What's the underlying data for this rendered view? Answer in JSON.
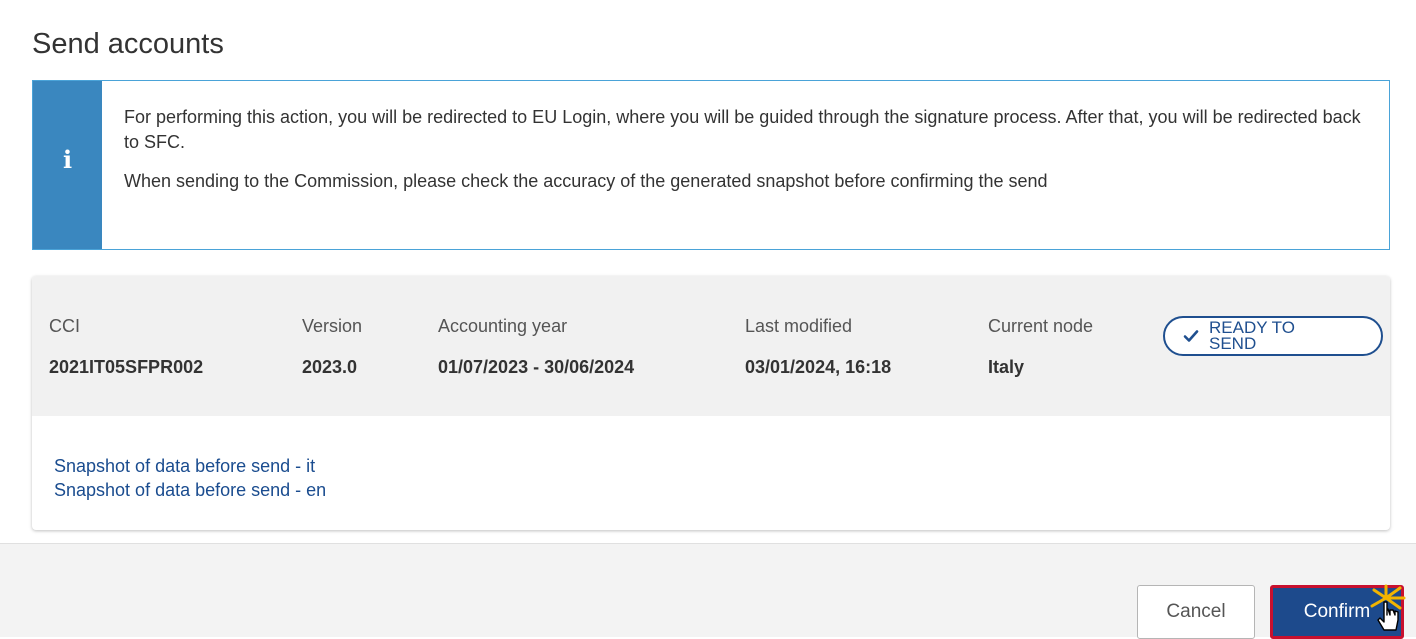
{
  "dialog": {
    "title": "Send accounts"
  },
  "info": {
    "icon": "info-icon",
    "paragraph_1": "For performing this action, you will be redirected to EU Login, where you will be guided through the signature process. After that, you will be redirected back to SFC.",
    "paragraph_2": "When sending to the Commission, please check the accuracy of the generated snapshot before confirming the send",
    "accent_color": "#3a87bf"
  },
  "summary": {
    "cci": {
      "label": "CCI",
      "value": "2021IT05SFPR002"
    },
    "version": {
      "label": "Version",
      "value": "2023.0"
    },
    "accounting_year": {
      "label": "Accounting year",
      "value": "01/07/2023 - 30/06/2024"
    },
    "last_modified": {
      "label": "Last modified",
      "value": "03/01/2024, 16:18"
    },
    "current_node": {
      "label": "Current node",
      "value": "Italy"
    },
    "status": {
      "text": "READY TO SEND",
      "icon": "check-icon",
      "color": "#1f4f8f"
    }
  },
  "snapshots": {
    "link_it": "Snapshot of data before send - it",
    "link_en": "Snapshot of data before send - en"
  },
  "footer": {
    "cancel_label": "Cancel",
    "confirm_label": "Confirm",
    "confirm_color": "#1d4a8c"
  }
}
